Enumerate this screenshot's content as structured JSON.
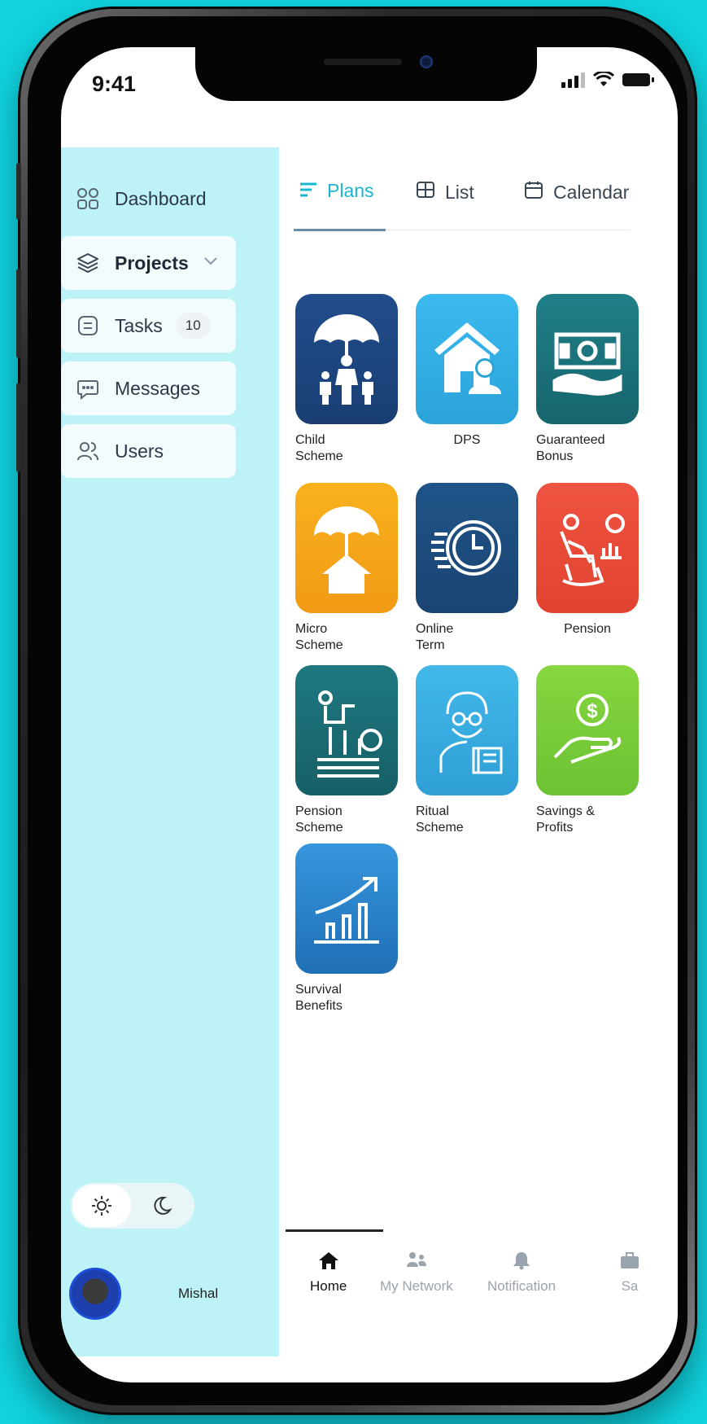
{
  "status": {
    "time": "9:41"
  },
  "sidebar": {
    "items": [
      {
        "label": "Dashboard",
        "icon": "grid-icon"
      },
      {
        "label": "Projects",
        "icon": "layers-icon",
        "expandable": true
      },
      {
        "label": "Tasks",
        "icon": "tasks-icon",
        "badge": "10"
      },
      {
        "label": "Messages",
        "icon": "message-icon"
      },
      {
        "label": "Users",
        "icon": "users-icon"
      }
    ],
    "theme_toggle": {
      "options": [
        "sun-icon",
        "moon-icon"
      ],
      "selected": "light"
    },
    "profile": {
      "name": "Mishal"
    }
  },
  "tabs": [
    {
      "label": "Plans",
      "icon": "lines-icon",
      "active": true
    },
    {
      "label": "List",
      "icon": "table-icon",
      "active": false
    },
    {
      "label": "Calendar",
      "icon": "calendar-icon",
      "active": false
    }
  ],
  "plans": [
    {
      "label": "Child\nScheme",
      "icon": "family-umbrella-icon",
      "color": "#1f4e8a"
    },
    {
      "label": "DPS",
      "icon": "house-person-icon",
      "color": "#33b2e6"
    },
    {
      "label": "Guaranteed\nBonus",
      "icon": "cash-hand-icon",
      "color": "#1c7a80"
    },
    {
      "label": "Micro\nScheme",
      "icon": "umbrella-house-icon",
      "color": "#f7a81b"
    },
    {
      "label": "Online\nTerm",
      "icon": "clock-icon",
      "color": "#1d4f82"
    },
    {
      "label": "Pension",
      "icon": "rocking-chair-icon",
      "color": "#ec4d3c"
    },
    {
      "label": "Pension\nScheme",
      "icon": "coins-pipe-icon",
      "color": "#1b6f77"
    },
    {
      "label": "Ritual\nScheme",
      "icon": "elder-man-icon",
      "color": "#38b0e3"
    },
    {
      "label": "Savings &\nProfits",
      "icon": "dollar-hand-icon",
      "color": "#7fd13b"
    },
    {
      "label": "Survival\nBenefits",
      "icon": "growth-chart-icon",
      "color": "#2b86d1"
    }
  ],
  "bottom_nav": [
    {
      "label": "Home",
      "icon": "home-icon",
      "active": true
    },
    {
      "label": "My Network",
      "icon": "network-icon",
      "active": false
    },
    {
      "label": "Notification",
      "icon": "bell-icon",
      "active": false
    },
    {
      "label": "Sa",
      "icon": "briefcase-icon",
      "active": false
    }
  ]
}
